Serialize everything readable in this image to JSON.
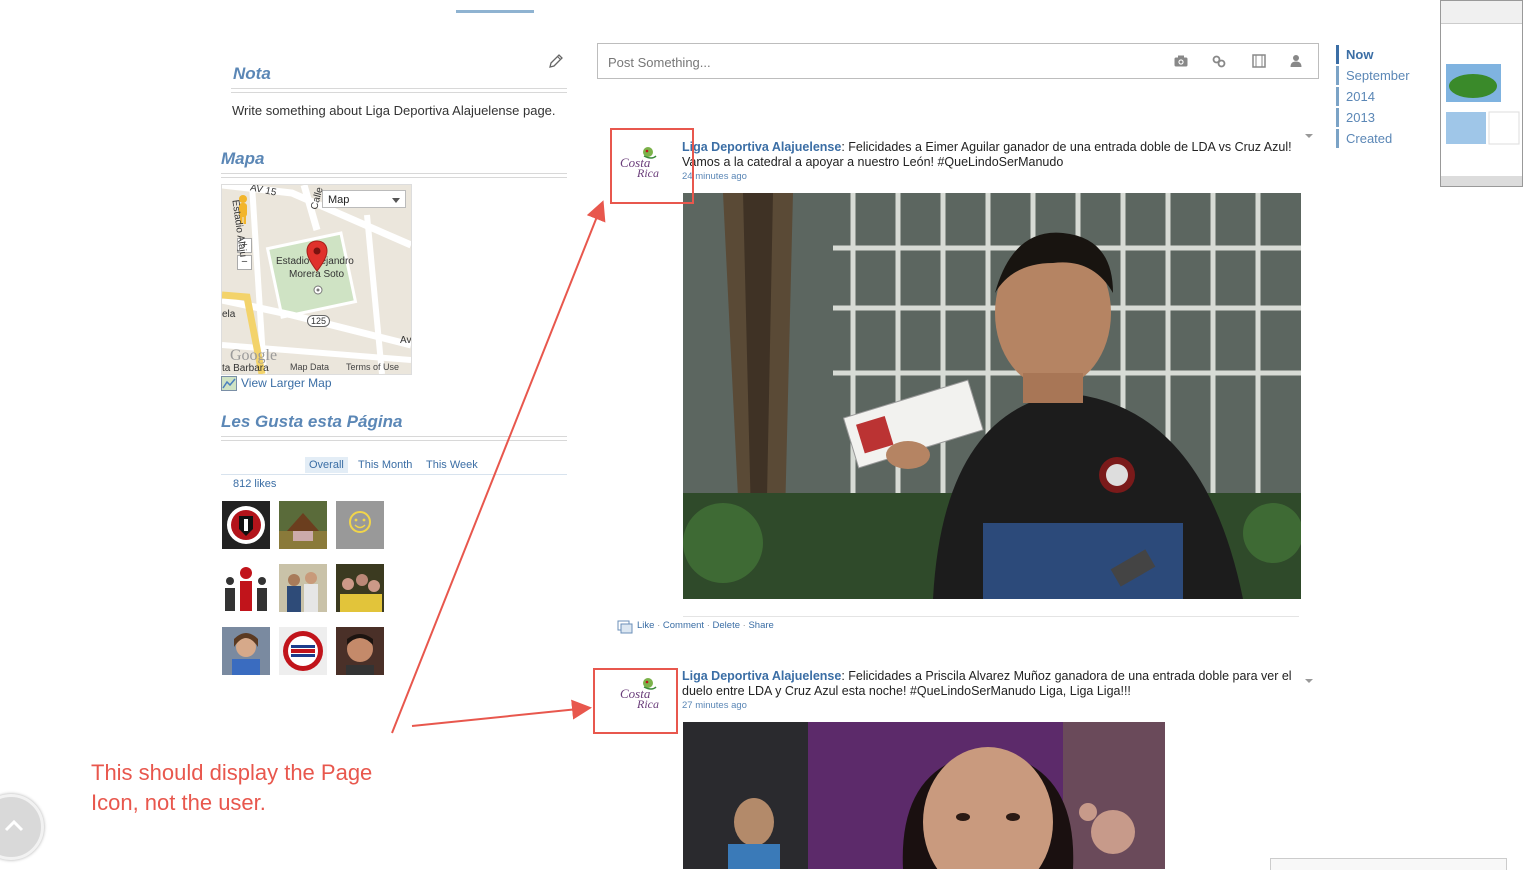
{
  "nota": {
    "title": "Nota",
    "text": "Write something about Liga Deportiva Alajuelense page."
  },
  "mapa": {
    "title": "Mapa",
    "map_type": "Map",
    "place_name_1": "Estadio Alejandro",
    "place_name_2": "Morera Soto",
    "street_labels": [
      "AV 15",
      "Calle",
      "Estadio Alaju",
      "ela",
      "ta Barbara",
      "Av"
    ],
    "road_number": "125",
    "map_data": "Map Data",
    "terms": "Terms of Use",
    "google": "Google",
    "larger_map": "View Larger Map"
  },
  "likes": {
    "title": "Les Gusta esta Página",
    "tabs": [
      "Overall",
      "This Month",
      "This Week"
    ],
    "count": "812 likes"
  },
  "composer": {
    "placeholder": "Post Something..."
  },
  "timeline": [
    "Now",
    "September",
    "2014",
    "2013",
    "Created"
  ],
  "posts": [
    {
      "author": "Liga Deportiva Alajuelense",
      "text": ": Felicidades a Eimer Aguilar ganador de una entrada doble de LDA vs Cruz Azul!  Vamos a la catedral a apoyar a nuestro León! #QueLindoSerManudo",
      "time": "24 minutes ago",
      "avatar_text_1": "Costa",
      "avatar_text_2": "Rica"
    },
    {
      "author": "Liga Deportiva Alajuelense",
      "text": ": Felicidades a Priscila Alvarez Muñoz ganadora de una entrada doble para ver el duelo entre LDA y Cruz Azul esta noche!  #QueLindoSerManudo Liga, Liga Liga!!!",
      "time": "27 minutes ago",
      "avatar_text_1": "Costa",
      "avatar_text_2": "Rica"
    }
  ],
  "post_actions": {
    "like": "Like",
    "comment": "Comment",
    "delete": "Delete",
    "share": "Share",
    "sep": "·"
  },
  "annotation": {
    "line1": "This should display the Page",
    "line2": "Icon, not the user."
  },
  "colors": {
    "link": "#3b6ea5",
    "annotation": "#e8574d"
  }
}
